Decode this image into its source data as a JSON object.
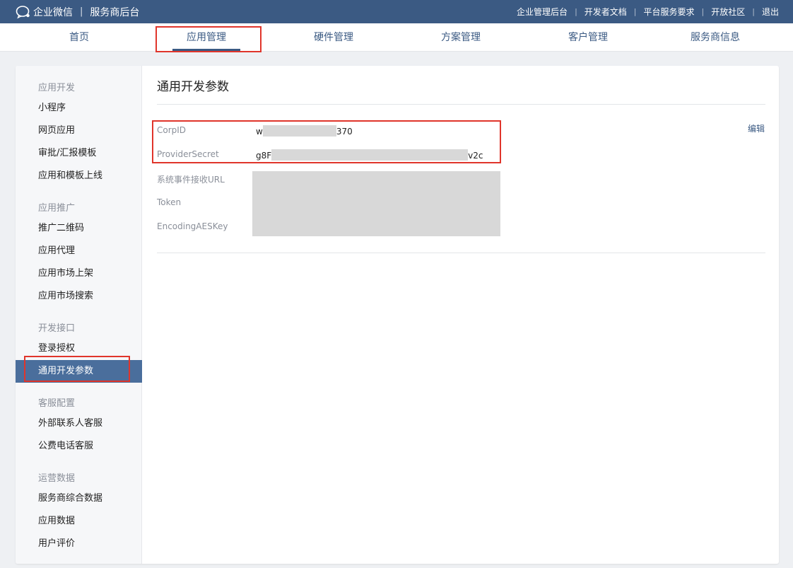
{
  "topbar": {
    "brand_name": "企业微信",
    "brand_separator": "|",
    "brand_subtitle": "服务商后台",
    "links": [
      "企业管理后台",
      "开发者文档",
      "平台服务要求",
      "开放社区",
      "退出"
    ]
  },
  "nav": {
    "items": [
      "首页",
      "应用管理",
      "硬件管理",
      "方案管理",
      "客户管理",
      "服务商信息"
    ],
    "active": "应用管理"
  },
  "sidebar": {
    "groups": [
      {
        "title": "应用开发",
        "items": [
          "小程序",
          "网页应用",
          "审批/汇报模板",
          "应用和模板上线"
        ]
      },
      {
        "title": "应用推广",
        "items": [
          "推广二维码",
          "应用代理",
          "应用市场上架",
          "应用市场搜索"
        ]
      },
      {
        "title": "开发接口",
        "items": [
          "登录授权",
          "通用开发参数"
        ]
      },
      {
        "title": "客服配置",
        "items": [
          "外部联系人客服",
          "公费电话客服"
        ]
      },
      {
        "title": "运营数据",
        "items": [
          "服务商综合数据",
          "应用数据",
          "用户评价"
        ]
      }
    ],
    "active_item": "通用开发参数"
  },
  "content": {
    "title": "通用开发参数",
    "edit_label": "编辑",
    "params": [
      {
        "label": "CorpID",
        "value_start": "w",
        "value_end": "370"
      },
      {
        "label": "ProviderSecret",
        "value_start": "g8F",
        "value_end": "v2c"
      },
      {
        "label": "系统事件接收URL"
      },
      {
        "label": "Token"
      },
      {
        "label": "EncodingAESKey"
      }
    ]
  },
  "colors": {
    "topbar_bg": "#3b5a83",
    "accent": "#3b5a83",
    "sidebar_active_bg": "#4a6e9c",
    "highlight_box": "#e0352b",
    "redaction": "#d8d8d8"
  },
  "icons": {
    "logo": "chat-bubble-logo-icon"
  }
}
